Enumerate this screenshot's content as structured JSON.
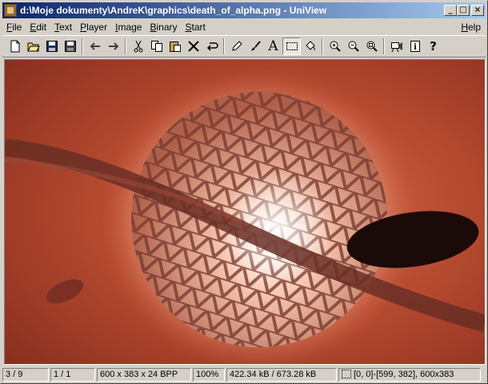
{
  "window": {
    "title": "d:\\Moje dokumenty\\AndreK\\graphics\\death_of_alpha.png - UniView",
    "controls": {
      "minimize": "_",
      "maximize": "□",
      "close": "×"
    }
  },
  "menu": {
    "items": [
      {
        "key": "F",
        "rest": "ile"
      },
      {
        "key": "E",
        "rest": "dit"
      },
      {
        "key": "T",
        "rest": "ext"
      },
      {
        "key": "P",
        "rest": "layer"
      },
      {
        "key": "I",
        "rest": "mage"
      },
      {
        "key": "B",
        "rest": "inary"
      },
      {
        "key": "S",
        "rest": "tart"
      }
    ],
    "help": {
      "key": "H",
      "rest": "elp"
    }
  },
  "toolbar": {
    "icons": [
      "new-icon",
      "open-icon",
      "save-icon",
      "save-all-icon",
      "back-icon",
      "forward-icon",
      "cut-icon",
      "copy-icon",
      "paste-icon",
      "delete-icon",
      "undo-icon",
      "pencil-icon",
      "brush-icon",
      "text-icon",
      "select-rect-icon",
      "fill-icon",
      "zoom-in-icon",
      "zoom-out-icon",
      "zoom-fit-icon",
      "slideshow-icon",
      "info-icon",
      "help-icon"
    ],
    "glyphs": {
      "text": "A",
      "help": "?",
      "info": "i"
    },
    "selected": "select-rect-icon"
  },
  "image": {
    "file": "death_of_alpha.png",
    "background": "#b04a32",
    "glow": "#f6c6a8"
  },
  "status": {
    "position": "3 / 9",
    "page": "1 / 1",
    "dimensions": "600 x 383 x 24 BPP",
    "zoom": "100%",
    "size": "422.34 kB / 673.28 kB",
    "selection": "[0, 0]-[599, 382], 600x383"
  }
}
